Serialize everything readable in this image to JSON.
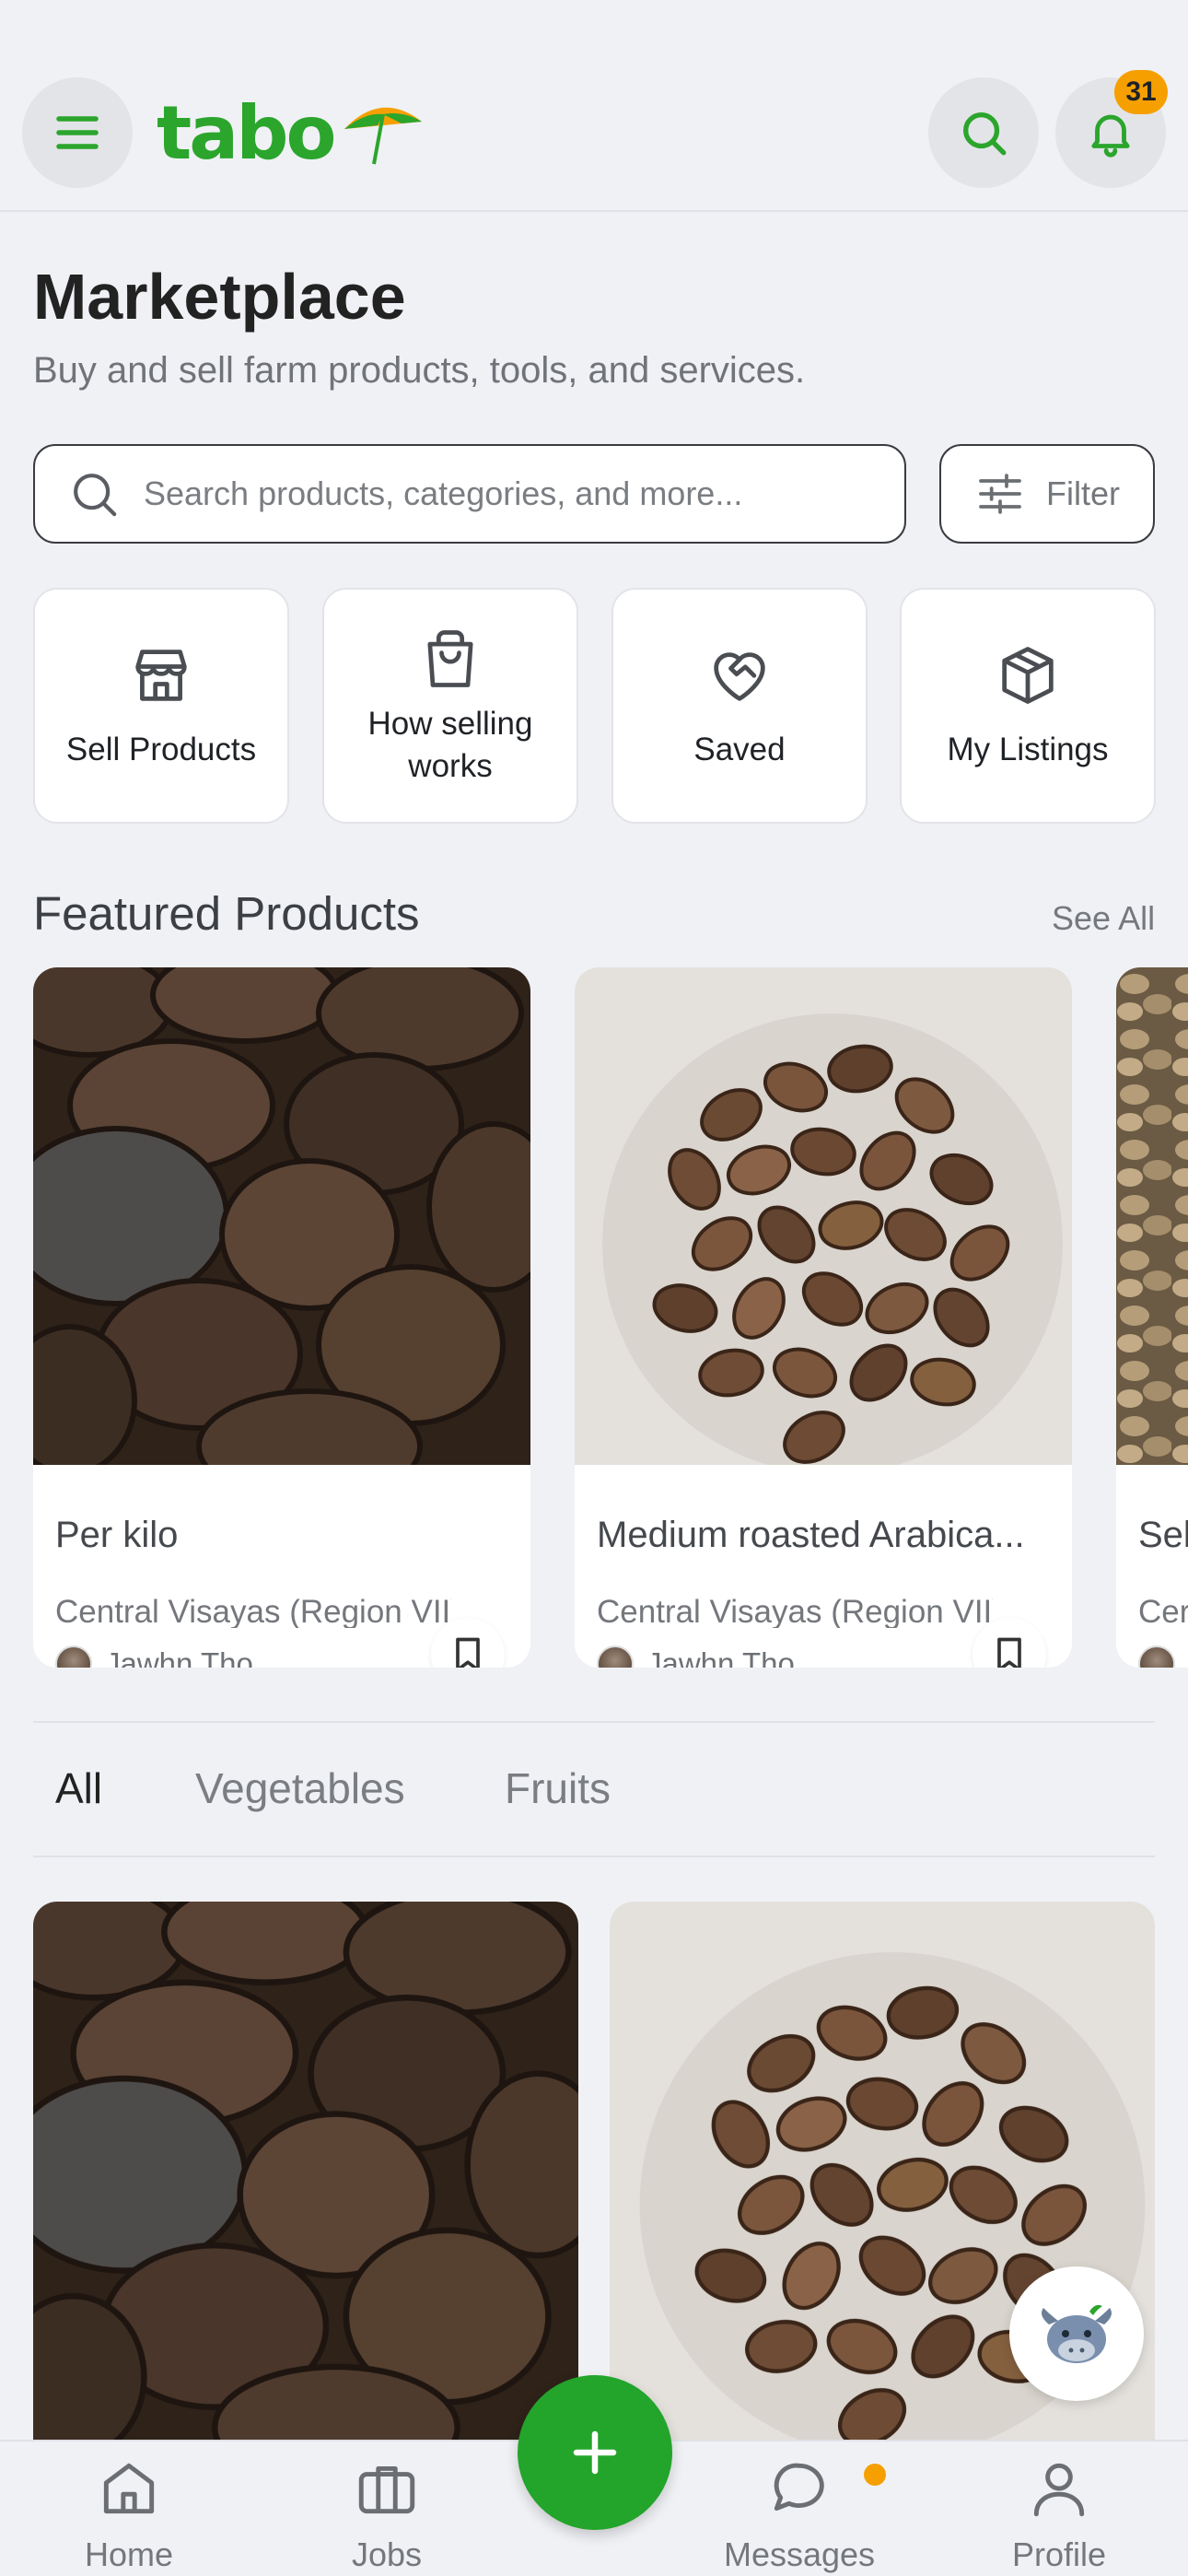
{
  "header": {
    "logo_text": "tabo",
    "notification_count": "31"
  },
  "page": {
    "title": "Marketplace",
    "subtitle": "Buy and sell farm products, tools, and services."
  },
  "search": {
    "placeholder": "Search products, categories, and more...",
    "filter_label": "Filter"
  },
  "quick_actions": [
    {
      "label": "Sell Products",
      "icon": "store-icon"
    },
    {
      "label": "How selling works",
      "icon": "shopping-bag-icon"
    },
    {
      "label": "Saved",
      "icon": "heart-handshake-icon"
    },
    {
      "label": "My Listings",
      "icon": "box-icon"
    }
  ],
  "featured": {
    "title": "Featured Products",
    "see_all": "See All",
    "items": [
      {
        "name": "Per kilo",
        "location": "Central Visayas (Region VII)",
        "seller": "Jawhn Tho"
      },
      {
        "name": "Medium roasted Arabica...",
        "location": "Central Visayas (Region VII)",
        "seller": "Jawhn Tho"
      },
      {
        "name": "Sel",
        "location": "Cer",
        "seller": ""
      }
    ]
  },
  "tabs": [
    "All",
    "Vegetables",
    "Fruits"
  ],
  "bottom_nav": [
    {
      "label": "Home",
      "icon": "home-icon"
    },
    {
      "label": "Jobs",
      "icon": "briefcase-icon"
    },
    {
      "label": "Messages",
      "icon": "chat-icon"
    },
    {
      "label": "Profile",
      "icon": "user-icon"
    }
  ],
  "colors": {
    "brand_green": "#2ba52c",
    "accent_orange": "#f5a000",
    "background": "#f0f1f5"
  }
}
